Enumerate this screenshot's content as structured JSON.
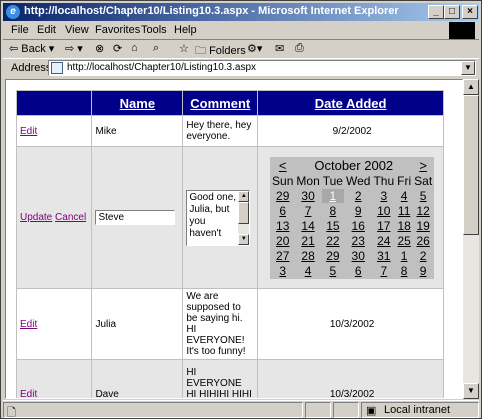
{
  "window": {
    "title": "http://localhost/Chapter10/Listing10.3.aspx - Microsoft Internet Explorer",
    "icon": "ie-icon"
  },
  "menu": [
    "File",
    "Edit",
    "View",
    "Favorites",
    "Tools",
    "Help"
  ],
  "toolbar": {
    "back": "Back",
    "folders": "Folders"
  },
  "address": {
    "label": "Address",
    "url": "http://localhost/Chapter10/Listing10.3.aspx"
  },
  "grid": {
    "headers": [
      "",
      "Name",
      "Comment",
      "Date Added"
    ],
    "rows": [
      {
        "action": "Edit",
        "name": "Mike",
        "comment": "Hey there, hey everyone.",
        "date": "9/2/2002"
      },
      {
        "action": "Edit",
        "name": "Julia",
        "comment": "We are supposed to be saying hi. HI EVERYONE! It's too funny!",
        "date": "10/3/2002"
      },
      {
        "action": "Edit",
        "name": "Dave",
        "comment": "HI EVERYONE HI HIHIHI HIHI HIIHIHI HI! HI! HELLO AND",
        "date": "10/3/2002"
      }
    ],
    "edit_row": {
      "update": "Update",
      "cancel": "Cancel",
      "name_value": "Steve",
      "comment_value": "Good one, Julia, but you haven't"
    }
  },
  "calendar": {
    "prev": "<",
    "next": ">",
    "title": "October 2002",
    "day_headers": [
      "Sun",
      "Mon",
      "Tue",
      "Wed",
      "Thu",
      "Fri",
      "Sat"
    ],
    "weeks": [
      [
        "29",
        "30",
        "1",
        "2",
        "3",
        "4",
        "5"
      ],
      [
        "6",
        "7",
        "8",
        "9",
        "10",
        "11",
        "12"
      ],
      [
        "13",
        "14",
        "15",
        "16",
        "17",
        "18",
        "19"
      ],
      [
        "20",
        "21",
        "22",
        "23",
        "24",
        "25",
        "26"
      ],
      [
        "27",
        "28",
        "29",
        "30",
        "31",
        "1",
        "2"
      ],
      [
        "3",
        "4",
        "5",
        "6",
        "7",
        "8",
        "9"
      ]
    ],
    "selected": "1"
  },
  "status": {
    "zone": "Local intranet"
  },
  "colors": {
    "header_bg": "#00008b",
    "visited_link": "#800080",
    "calendar_bg": "#c0c0c0"
  }
}
